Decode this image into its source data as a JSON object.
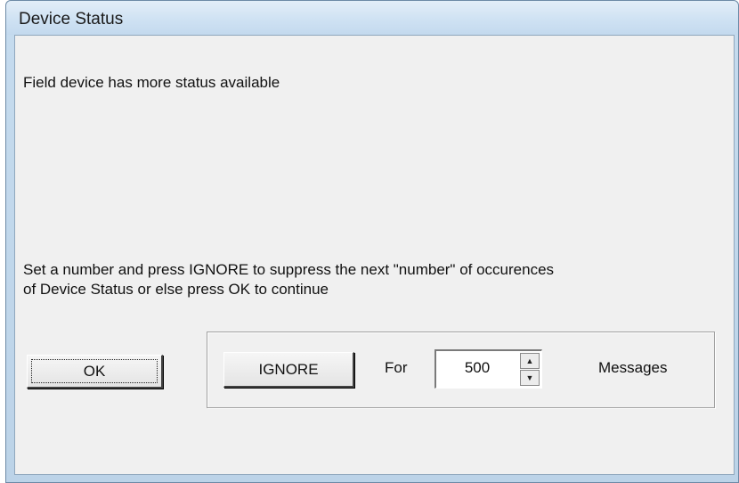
{
  "window": {
    "title": "Device Status"
  },
  "body": {
    "status_message": "Field device has more status available",
    "instruction_line1": "Set a number and press IGNORE to suppress the next \"number\" of occurences",
    "instruction_line2": "of Device Status or else press OK to continue"
  },
  "buttons": {
    "ok_label": "OK",
    "ignore_label": "IGNORE"
  },
  "ignore_group": {
    "for_label": "For",
    "count_value": "500",
    "messages_label": "Messages",
    "spin_up_glyph": "▲",
    "spin_down_glyph": "▼"
  }
}
